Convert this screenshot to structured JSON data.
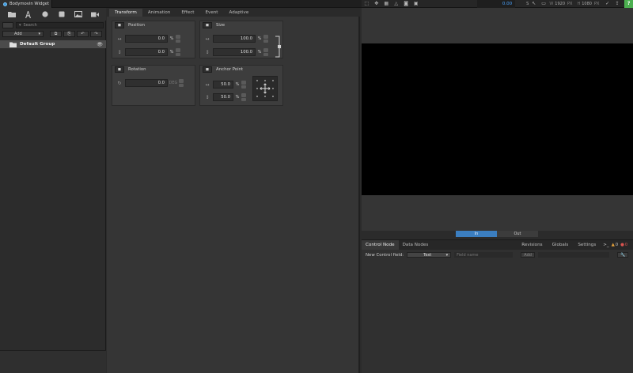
{
  "window": {
    "app_title": "Bodymovin Widget"
  },
  "left_panel": {
    "toolbar_icons": [
      "folder-icon",
      "text-icon",
      "circle-icon",
      "square-icon",
      "image-icon",
      "video-icon"
    ],
    "search_placeholder": "Search",
    "add_label": "Add",
    "group_name": "Default Group"
  },
  "center": {
    "tabs": [
      {
        "label": "Transform",
        "active": true
      },
      {
        "label": "Animation"
      },
      {
        "label": "Effect"
      },
      {
        "label": "Event"
      },
      {
        "label": "Adaptive"
      }
    ],
    "position": {
      "title": "Position",
      "x": "0.0",
      "y": "0.0",
      "unit": "%"
    },
    "size": {
      "title": "Size",
      "width": "100.0",
      "height": "100.0",
      "unit": "%"
    },
    "rotation": {
      "title": "Rotation",
      "value": "0.0",
      "unit": "DEG"
    },
    "anchor": {
      "title": "Anchor Point",
      "x": "50.0",
      "y": "50.0",
      "unit": "%"
    }
  },
  "viewer": {
    "time": "0.00",
    "time_unit": "S",
    "width_label": "W",
    "width": "1920",
    "width_unit": "PX",
    "height_label": "H",
    "height": "1080",
    "height_unit": "PX",
    "in_label": "In",
    "out_label": "Out"
  },
  "node_panel": {
    "tabs": [
      {
        "label": "Control Node",
        "active": true
      },
      {
        "label": "Data Nodes"
      }
    ],
    "right_tabs": [
      "Revisions",
      "Globals",
      "Settings"
    ],
    "console_label": ">_",
    "warnings": "0",
    "errors": "0",
    "new_field_label": "New Control field:",
    "type_value": "Text",
    "fieldname_placeholder": "Field name",
    "add_label": "Add"
  },
  "colors": {
    "accent": "#3b7ec0",
    "help": "#4caf50",
    "warning": "#e6a23c",
    "error": "#d9534f"
  }
}
